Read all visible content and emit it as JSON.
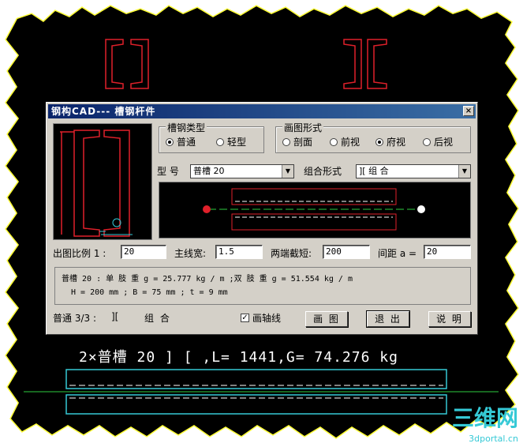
{
  "dialog": {
    "title": "钢构CAD--- 槽钢杆件",
    "close_label": "×"
  },
  "type_group": {
    "title": "槽钢类型",
    "options": [
      {
        "label": "普通",
        "selected": true
      },
      {
        "label": "轻型",
        "selected": false
      }
    ]
  },
  "draw_group": {
    "title": "画图形式",
    "options": [
      {
        "label": "剖面",
        "selected": false
      },
      {
        "label": "前视",
        "selected": false
      },
      {
        "label": "府视",
        "selected": true
      },
      {
        "label": "后视",
        "selected": false
      }
    ]
  },
  "model": {
    "label": "型 号",
    "value": "普槽 20"
  },
  "combo": {
    "label": "组合形式",
    "value": "][    组 合"
  },
  "params": {
    "scale_label": "出图比例 1 :",
    "scale_value": "20",
    "line_label": "主线宽:",
    "line_value": "1.5",
    "cut_label": "两端截短:",
    "cut_value": "200",
    "gap_label": "间距 a =",
    "gap_value": "20"
  },
  "info": {
    "line1": "普槽 20 : 单 肢 重 g = 25.777 kg / m ;双 肢 重 g = 51.554 kg / m",
    "line2": "H = 200 mm ; B = 75 mm ; t = 9 mm"
  },
  "status": {
    "count": "普通  3/3 :",
    "symbol": "][",
    "combo": "组 合"
  },
  "axis_check": {
    "label": "画轴线",
    "checked": true
  },
  "buttons": {
    "draw": "画 图",
    "exit": "退 出",
    "help": "说 明"
  },
  "caption": "2×普槽 20 ] [ ,L= 1441,G= 74.276 kg",
  "watermark": {
    "brand": "三维网",
    "url": "3dportal.cn"
  },
  "colors": {
    "cad_bg": "#000000",
    "frame_glow": "#ffff00",
    "profile_red": "#e0202a",
    "cyan": "#35c9d6",
    "axis_green": "#2ecc40",
    "dialog_bg": "#d4d0c8",
    "title_blue": "#0a246a"
  }
}
